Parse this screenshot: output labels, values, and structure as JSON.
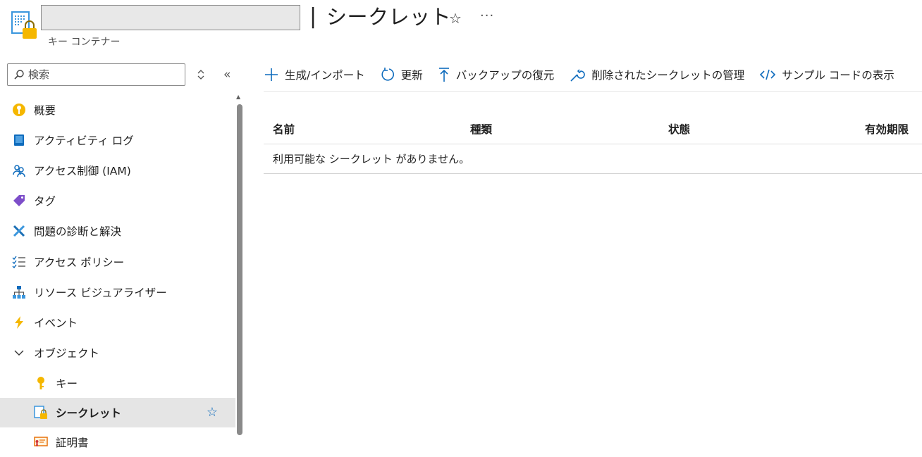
{
  "header": {
    "title": "シークレット",
    "separator": "|",
    "subtitle": "キー コンテナー",
    "more": "···"
  },
  "sidebar": {
    "search_placeholder": "検索",
    "items": [
      {
        "label": "概要",
        "icon": "key-circle-icon"
      },
      {
        "label": "アクティビティ ログ",
        "icon": "log-book-icon"
      },
      {
        "label": "アクセス制御 (IAM)",
        "icon": "people-icon"
      },
      {
        "label": "タグ",
        "icon": "tag-icon"
      },
      {
        "label": "問題の診断と解決",
        "icon": "wrench-icon"
      },
      {
        "label": "アクセス ポリシー",
        "icon": "checklist-icon"
      },
      {
        "label": "リソース ビジュアライザー",
        "icon": "hierarchy-icon"
      },
      {
        "label": "イベント",
        "icon": "lightning-icon"
      },
      {
        "label": "オブジェクト",
        "icon": "chevron-down-icon"
      }
    ],
    "subitems": [
      {
        "label": "キー",
        "icon": "key-icon"
      },
      {
        "label": "シークレット",
        "icon": "secret-icon",
        "selected": true
      },
      {
        "label": "証明書",
        "icon": "certificate-icon"
      }
    ]
  },
  "toolbar": {
    "generate": "生成/インポート",
    "refresh": "更新",
    "restore": "バックアップの復元",
    "deleted": "削除されたシークレットの管理",
    "sample": "サンプル コードの表示"
  },
  "table": {
    "columns": [
      "名前",
      "種類",
      "状態",
      "有効期限"
    ],
    "empty_message": "利用可能な シークレット がありません。"
  },
  "colors": {
    "accent": "#0f6cbd",
    "selected_bg": "#e5e5e5",
    "key_yellow": "#f5b700"
  }
}
